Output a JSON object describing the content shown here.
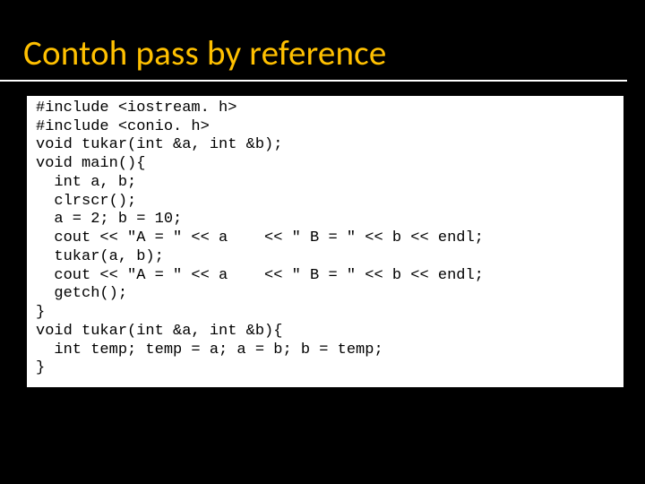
{
  "slide": {
    "title": "Contoh pass by reference",
    "code_lines": [
      "#include <iostream. h>",
      "#include <conio. h>",
      "void tukar(int &a, int &b);",
      "void main(){",
      "  int a, b;",
      "  clrscr();",
      "  a = 2; b = 10;",
      "  cout << \"A = \" << a    << \" B = \" << b << endl;",
      "  tukar(a, b);",
      "  cout << \"A = \" << a    << \" B = \" << b << endl;",
      "  getch();",
      "}",
      "void tukar(int &a, int &b){",
      "  int temp; temp = a; a = b; b = temp;",
      "}"
    ]
  }
}
